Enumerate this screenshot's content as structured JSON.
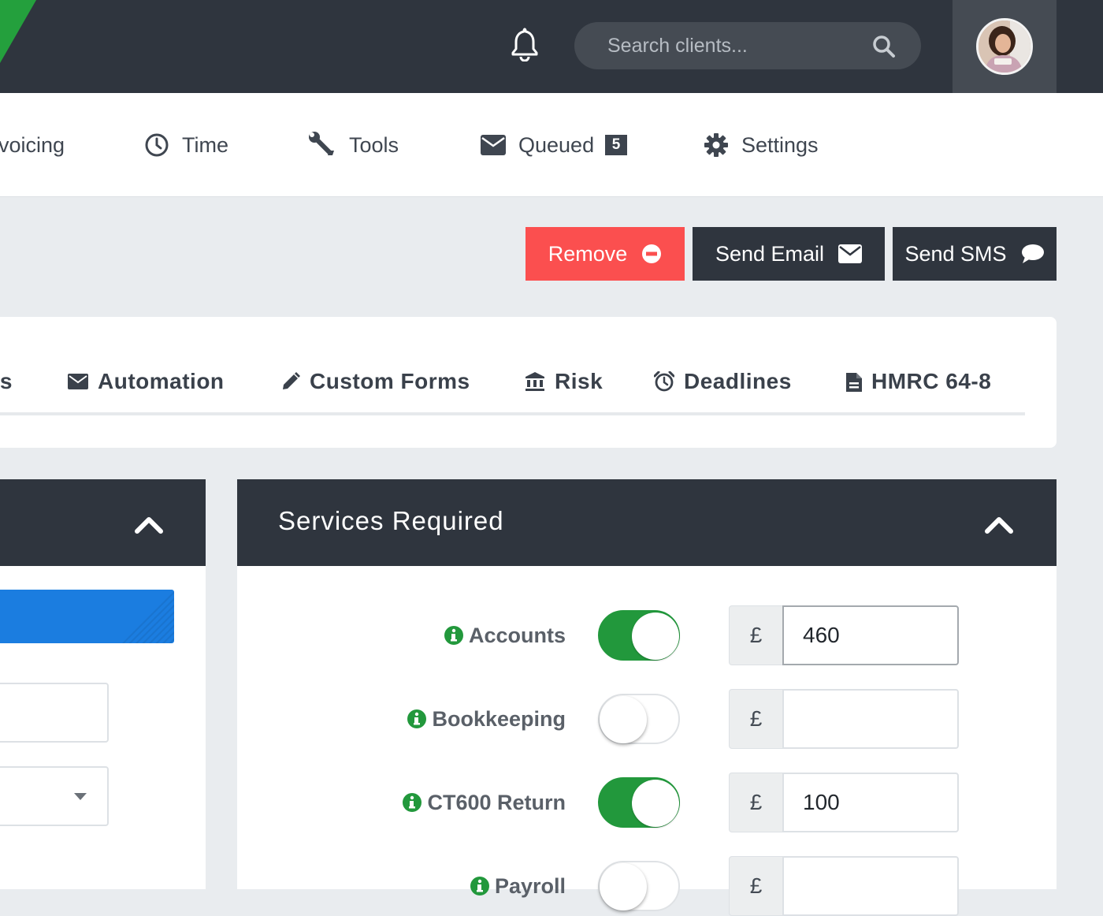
{
  "header": {
    "search": {
      "placeholder": "Search clients..."
    }
  },
  "nav": {
    "items": [
      {
        "label": "voicing",
        "icon": "invoice-icon"
      },
      {
        "label": "Time",
        "icon": "clock-icon"
      },
      {
        "label": "Tools",
        "icon": "wrench-icon"
      },
      {
        "label": "Queued",
        "icon": "envelope-icon",
        "badge": "5"
      },
      {
        "label": "Settings",
        "icon": "gear-icon"
      }
    ]
  },
  "actions": {
    "remove": "Remove",
    "send_email": "Send Email",
    "send_sms": "Send SMS"
  },
  "tabs": [
    {
      "label": "ts"
    },
    {
      "label": "Automation",
      "icon": "envelope-icon"
    },
    {
      "label": "Custom Forms",
      "icon": "pencil-icon"
    },
    {
      "label": "Risk",
      "icon": "bank-icon"
    },
    {
      "label": "Deadlines",
      "icon": "alarm-clock-icon"
    },
    {
      "label": "HMRC 64-8",
      "icon": "document-icon"
    }
  ],
  "services": {
    "title": "Services Required",
    "currency_symbol": "£",
    "rows": [
      {
        "label": "Accounts",
        "enabled": true,
        "value": "460"
      },
      {
        "label": "Bookkeeping",
        "enabled": false,
        "value": ""
      },
      {
        "label": "CT600 Return",
        "enabled": true,
        "value": "100"
      },
      {
        "label": "Payroll",
        "enabled": false,
        "value": ""
      }
    ]
  },
  "colors": {
    "topbar": "#2f353e",
    "brand_green": "#24a03d",
    "remove_red": "#fb4f4f",
    "toggle_on": "#22983c",
    "primary_blue": "#1b7de0"
  }
}
